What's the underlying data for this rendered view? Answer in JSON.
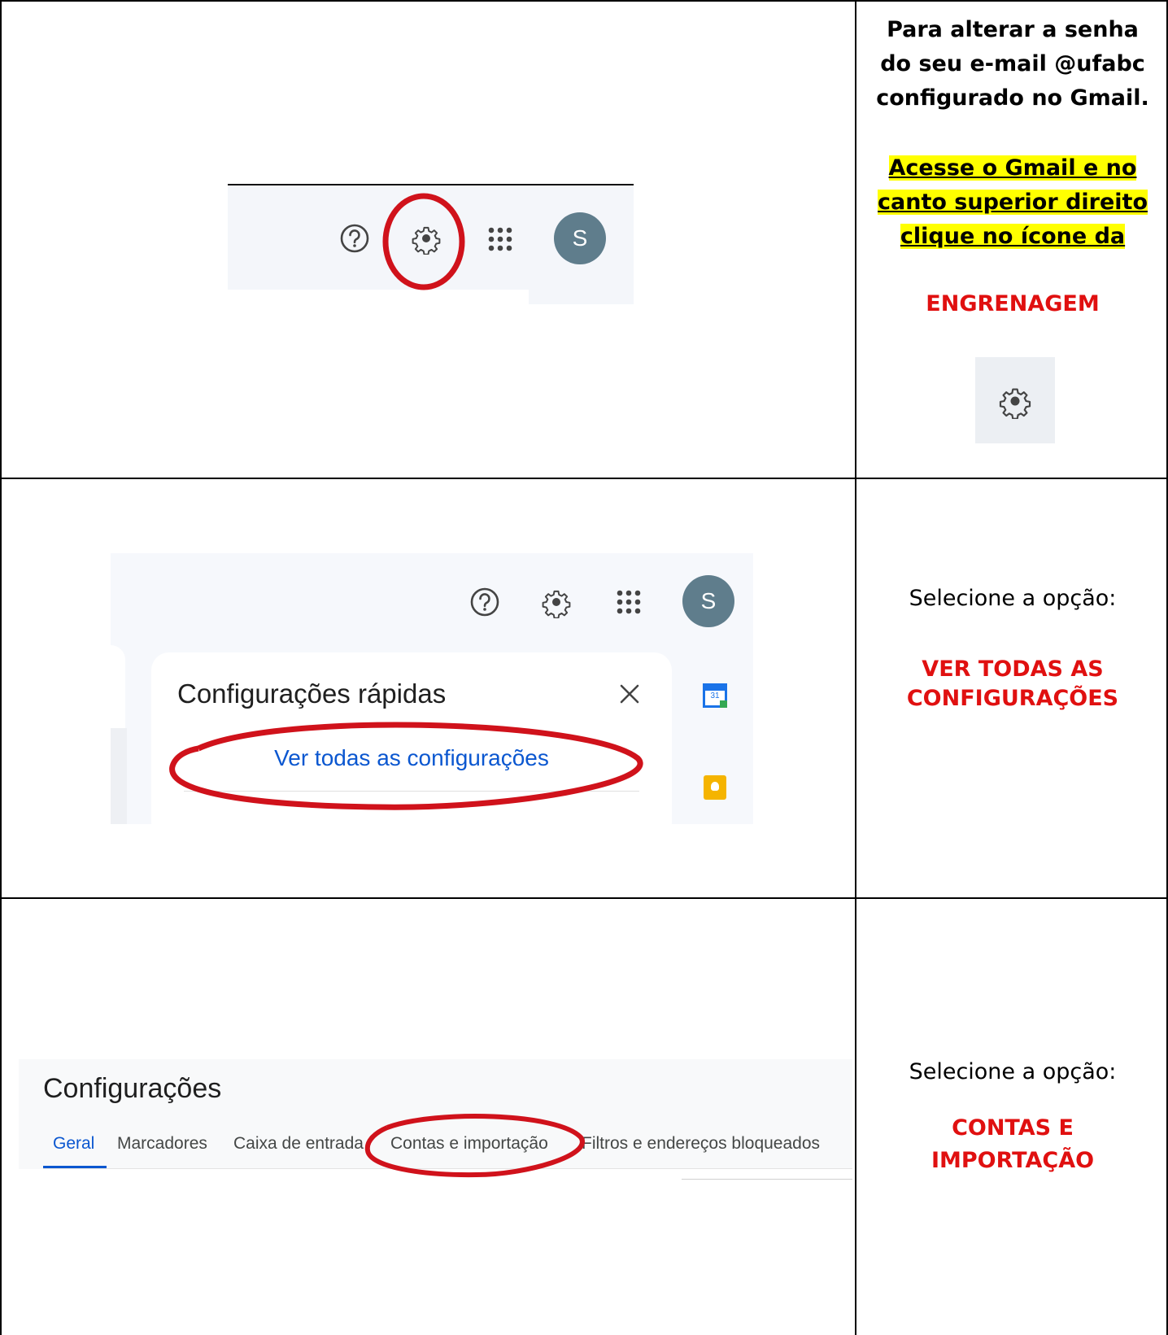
{
  "row1": {
    "title": "Para alterar a senha do seu e-mail @ufabc configurado no Gmail.",
    "instruction": "Acesse o Gmail e no canto superior direito clique no ícone da",
    "keyword": "ENGRENAGEM",
    "avatar_letter": "S",
    "icons": [
      "help-icon",
      "gear-icon",
      "apps-grid-icon",
      "avatar"
    ]
  },
  "row2": {
    "instruction": "Selecione a opção:",
    "keyword": "VER TODAS AS CONFIGURAÇÕES",
    "avatar_letter": "S",
    "quick_settings_title": "Configurações rápidas",
    "see_all_label": "Ver todas as configurações",
    "calendar_day": "31"
  },
  "row3": {
    "instruction": "Selecione a opção:",
    "keyword": "CONTAS E IMPORTAÇÃO",
    "settings_title": "Configurações",
    "tabs": [
      "Geral",
      "Marcadores",
      "Caixa de entrada",
      "Contas e importação",
      "Filtros e endereços bloqueados"
    ]
  },
  "colors": {
    "highlight": "#ffff00",
    "red": "#e01010",
    "avatar": "#5f7d8c",
    "accent": "#0b57d0"
  }
}
